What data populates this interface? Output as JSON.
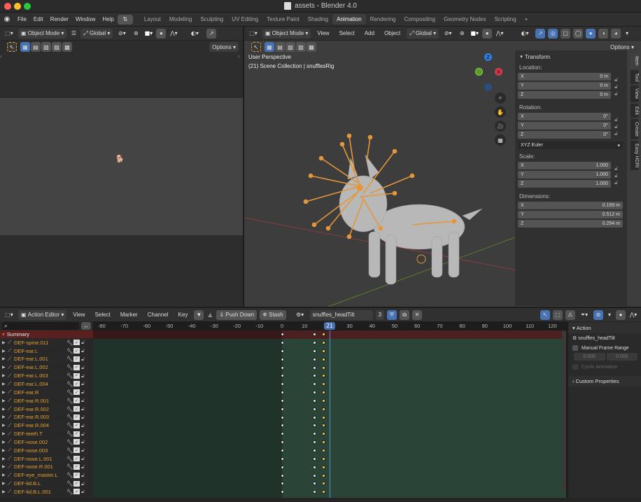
{
  "window": {
    "title": "assets - Blender 4.0"
  },
  "menubar": {
    "items": [
      "File",
      "Edit",
      "Render",
      "Window",
      "Help"
    ],
    "workspaces": [
      "Layout",
      "Modeling",
      "Sculpting",
      "UV Editing",
      "Texture Paint",
      "Shading",
      "Animation",
      "Rendering",
      "Compositing",
      "Geometry Nodes",
      "Scripting"
    ],
    "active_workspace": "Animation",
    "add_tab": "+"
  },
  "left_view": {
    "mode": "Object Mode",
    "orientation": "Global",
    "options": "Options"
  },
  "viewport": {
    "mode": "Object Mode",
    "menus": [
      "View",
      "Select",
      "Add",
      "Object"
    ],
    "orientation": "Global",
    "options": "Options",
    "overlay_title": "User Perspective",
    "overlay_sub": "(21) Scene Collection | snufflesRig"
  },
  "transform": {
    "title": "Transform",
    "location_label": "Location:",
    "location": [
      {
        "axis": "X",
        "value": "0 m"
      },
      {
        "axis": "Y",
        "value": "0 m"
      },
      {
        "axis": "Z",
        "value": "0 m"
      }
    ],
    "rotation_label": "Rotation:",
    "rotation": [
      {
        "axis": "X",
        "value": "0°"
      },
      {
        "axis": "Y",
        "value": "0°"
      },
      {
        "axis": "Z",
        "value": "0°"
      }
    ],
    "rotation_mode": "XYZ Euler",
    "scale_label": "Scale:",
    "scale": [
      {
        "axis": "X",
        "value": "1.000"
      },
      {
        "axis": "Y",
        "value": "1.000"
      },
      {
        "axis": "Z",
        "value": "1.000"
      }
    ],
    "dimensions_label": "Dimensions:",
    "dimensions": [
      {
        "axis": "X",
        "value": "0.169 m"
      },
      {
        "axis": "Y",
        "value": "0.512 m"
      },
      {
        "axis": "Z",
        "value": "0.294 m"
      }
    ]
  },
  "sidebar_tabs": [
    "Item",
    "Tool",
    "View",
    "Edit",
    "Create",
    "Easy HDRI"
  ],
  "gizmo": {
    "x": "X",
    "y": "Y",
    "z": "Z"
  },
  "action_editor": {
    "mode": "Action Editor",
    "menus": [
      "View",
      "Select",
      "Marker",
      "Channel",
      "Key"
    ],
    "push_down": "Push Down",
    "stash": "Stash",
    "action_name": "snuffles_headTilt",
    "users": "3",
    "ruler": [
      "-80",
      "-70",
      "-60",
      "-50",
      "-40",
      "-30",
      "-20",
      "-10",
      "0",
      "10",
      "21",
      "30",
      "40",
      "50",
      "60",
      "70",
      "80",
      "90",
      "100",
      "110",
      "120"
    ],
    "current_frame": "21",
    "summary": "Summary",
    "channels": [
      "DEF-spine.011",
      "DEF-ear.L",
      "DEF-ear.L.001",
      "DEF-ear.L.002",
      "DEF-ear.L.003",
      "DEF-ear.L.004",
      "DEF-ear.R",
      "DEF-ear.R.001",
      "DEF-ear.R.002",
      "DEF-ear.R.003",
      "DEF-ear.R.004",
      "DEF-teeth.T",
      "DEF-nose.002",
      "DEF-nose.003",
      "DEF-nose.L.001",
      "DEF-nose.R.001",
      "DEF-eye_master.L",
      "DEF-lid.B.L",
      "DEF-lid.B.L.001"
    ]
  },
  "action_panel": {
    "title": "Action",
    "action_name": "snuffles_headTilt",
    "manual_frame_range": "Manual Frame Range",
    "start": "0.000",
    "end": "0.000",
    "cyclic": "Cyclic Animation",
    "custom_properties": "Custom Properties"
  }
}
